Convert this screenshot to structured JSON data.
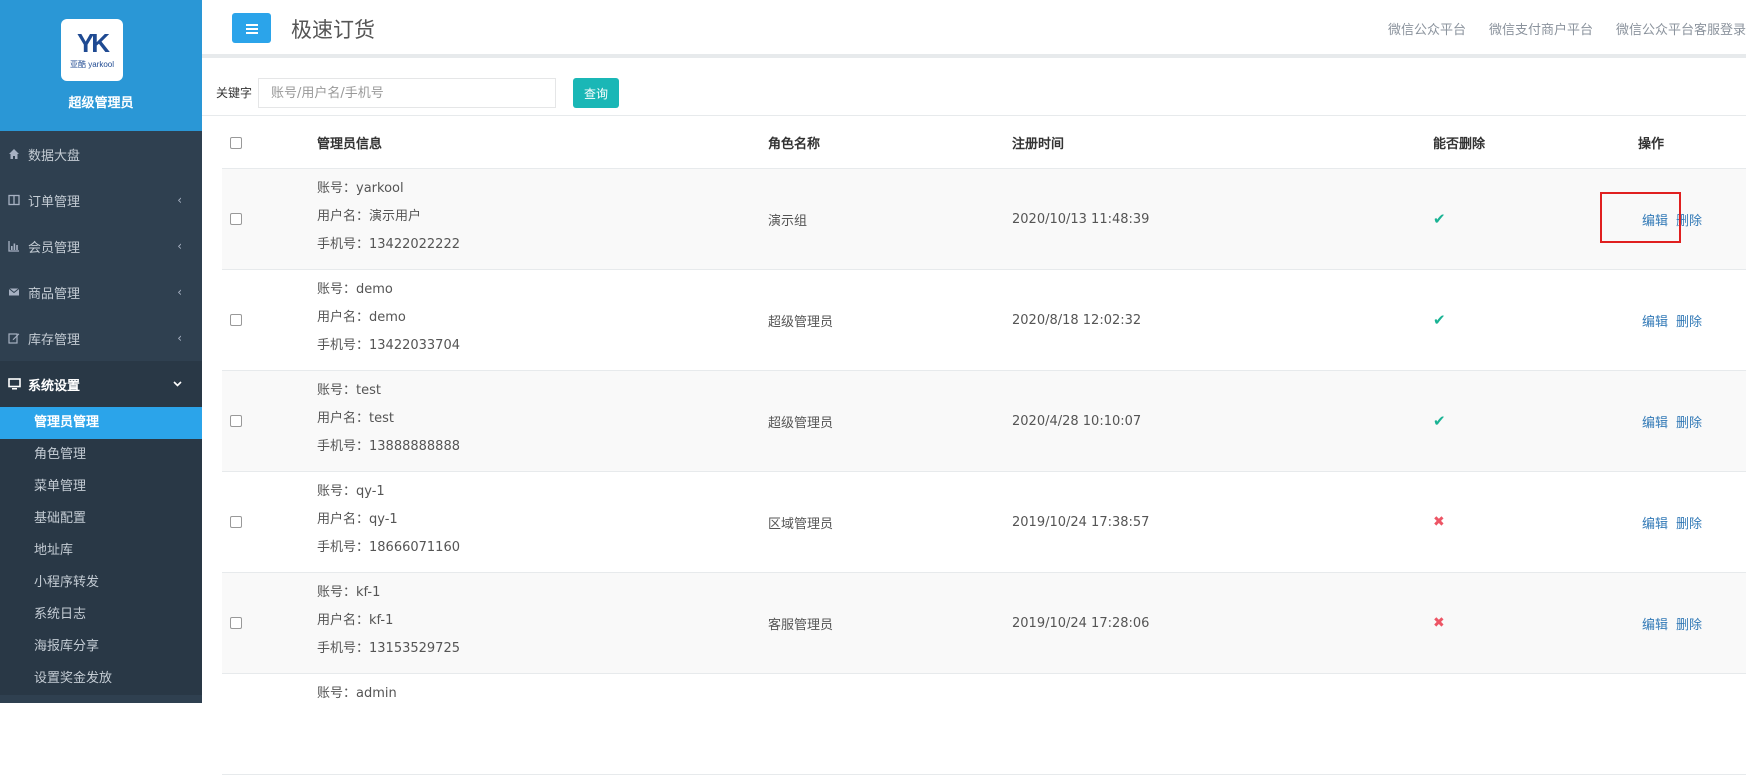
{
  "brand": {
    "logo_mark": "YK",
    "logo_sub": "亚酷 yarkool",
    "name": "超级管理员"
  },
  "sidebar": {
    "items": [
      {
        "label": "数据大盘",
        "icon": "home-icon"
      },
      {
        "label": "订单管理",
        "icon": "columns-icon"
      },
      {
        "label": "会员管理",
        "icon": "bar-chart-icon"
      },
      {
        "label": "商品管理",
        "icon": "envelope-icon"
      },
      {
        "label": "库存管理",
        "icon": "edit-icon"
      },
      {
        "label": "系统设置",
        "icon": "desktop-icon"
      }
    ],
    "subitems": [
      {
        "label": "管理员管理"
      },
      {
        "label": "角色管理"
      },
      {
        "label": "菜单管理"
      },
      {
        "label": "基础配置"
      },
      {
        "label": "地址库"
      },
      {
        "label": "小程序转发"
      },
      {
        "label": "系统日志"
      },
      {
        "label": "海报库分享"
      },
      {
        "label": "设置奖金发放"
      }
    ]
  },
  "header": {
    "title": "极速订货",
    "links": [
      {
        "label": "微信公众平台"
      },
      {
        "label": "微信支付商户平台"
      },
      {
        "label": "微信公众平台客服登录"
      }
    ]
  },
  "search": {
    "label": "关键字",
    "placeholder": "账号/用户名/手机号",
    "button": "查询"
  },
  "table": {
    "headers": {
      "info": "管理员信息",
      "role": "角色名称",
      "time": "注册时间",
      "deletable": "能否删除",
      "action": "操作"
    },
    "rows": [
      {
        "account": "账号：yarkool",
        "username": "用户名：演示用户",
        "phone": "手机号：13422022222",
        "role": "演示组",
        "time": "2020/10/13 11:48:39",
        "deletable": "✔",
        "edit": "编辑",
        "delete": "删除"
      },
      {
        "account": "账号：demo",
        "username": "用户名：demo",
        "phone": "手机号：13422033704",
        "role": "超级管理员",
        "time": "2020/8/18 12:02:32",
        "deletable": "✔",
        "edit": "编辑",
        "delete": "删除"
      },
      {
        "account": "账号：test",
        "username": "用户名：test",
        "phone": "手机号：13888888888",
        "role": "超级管理员",
        "time": "2020/4/28 10:10:07",
        "deletable": "✔",
        "edit": "编辑",
        "delete": "删除"
      },
      {
        "account": "账号：qy-1",
        "username": "用户名：qy-1",
        "phone": "手机号：18666071160",
        "role": "区域管理员",
        "time": "2019/10/24 17:38:57",
        "deletable": "✖",
        "edit": "编辑",
        "delete": "删除"
      },
      {
        "account": "账号：kf-1",
        "username": "用户名：kf-1",
        "phone": "手机号：13153529725",
        "role": "客服管理员",
        "time": "2019/10/24 17:28:06",
        "deletable": "✖",
        "edit": "编辑",
        "delete": "删除"
      },
      {
        "account": "账号：admin"
      }
    ]
  },
  "colors": {
    "sidebar_bg": "#2f4050",
    "brand_bg": "#2a97d6",
    "active_item": "#2ba4ea",
    "search_button": "#1ab7b6",
    "yes": "#1ab394",
    "no": "#ed5565",
    "link": "#337ab7",
    "highlight": "#e02020"
  }
}
